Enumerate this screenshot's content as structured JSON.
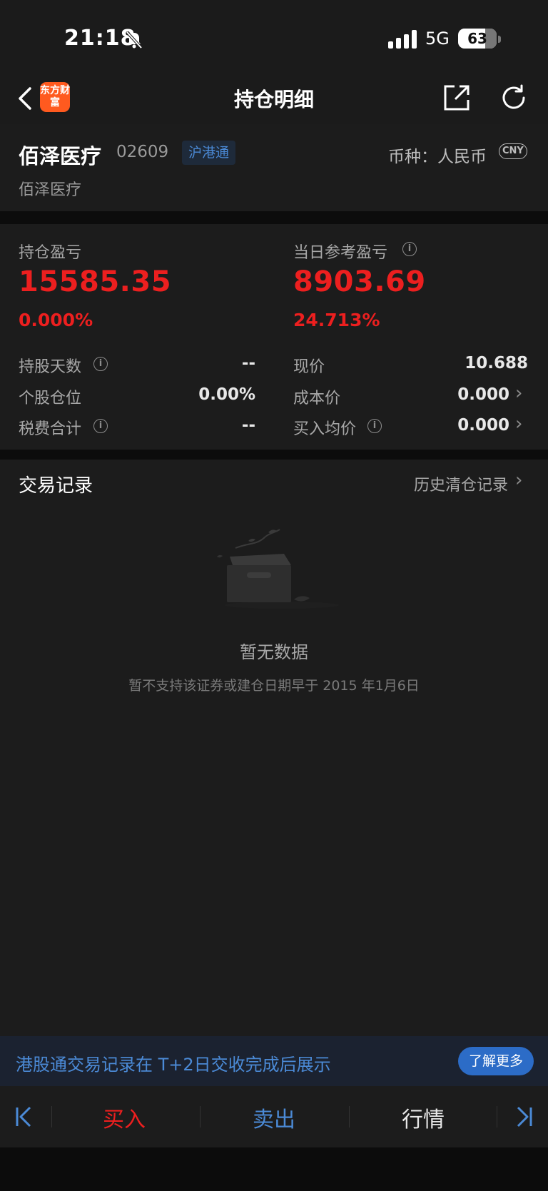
{
  "status_bar": {
    "time": "21:18",
    "network": "5G",
    "battery": "63"
  },
  "nav": {
    "title": "持仓明细",
    "logo_text": "东方财富",
    "logo_color": "#ff5a1f"
  },
  "stock": {
    "name": "佰泽医疗",
    "code": "02609",
    "market_tag": "沪港通",
    "currency_label": "币种：人民币",
    "currency_badge": "CNY",
    "sub_name": "佰泽医疗"
  },
  "metrics": {
    "position_pl": {
      "label": "持仓盈亏",
      "value": "15585.35",
      "pct": "0.000%"
    },
    "daily_pl": {
      "label": "当日参考盈亏",
      "value": "8903.69",
      "pct": "24.713%"
    },
    "rows": [
      {
        "left_label": "持股天数",
        "left_value": "--",
        "right_label": "现价",
        "right_value": "10.688"
      },
      {
        "left_label": "个股仓位",
        "left_value": "0.00%",
        "right_label": "成本价",
        "right_value": "0.000"
      },
      {
        "left_label": "税费合计",
        "left_value": "--",
        "right_label": "买入均价",
        "right_value": "0.000"
      }
    ]
  },
  "trades": {
    "title": "交易记录",
    "history_link": "历史清仓记录",
    "empty_title": "暂无数据",
    "empty_desc": "暂不支持该证券或建仓日期早于 2015 年1月6日"
  },
  "notice": {
    "text": "港股通交易记录在 T+2日交收完成后展示",
    "button": "了解更多"
  },
  "bottom": {
    "buy": "买入",
    "sell": "卖出",
    "quote": "行情"
  },
  "colors": {
    "red": "#ec1f1f",
    "blue": "#4b8ad6",
    "background": "#151515"
  }
}
